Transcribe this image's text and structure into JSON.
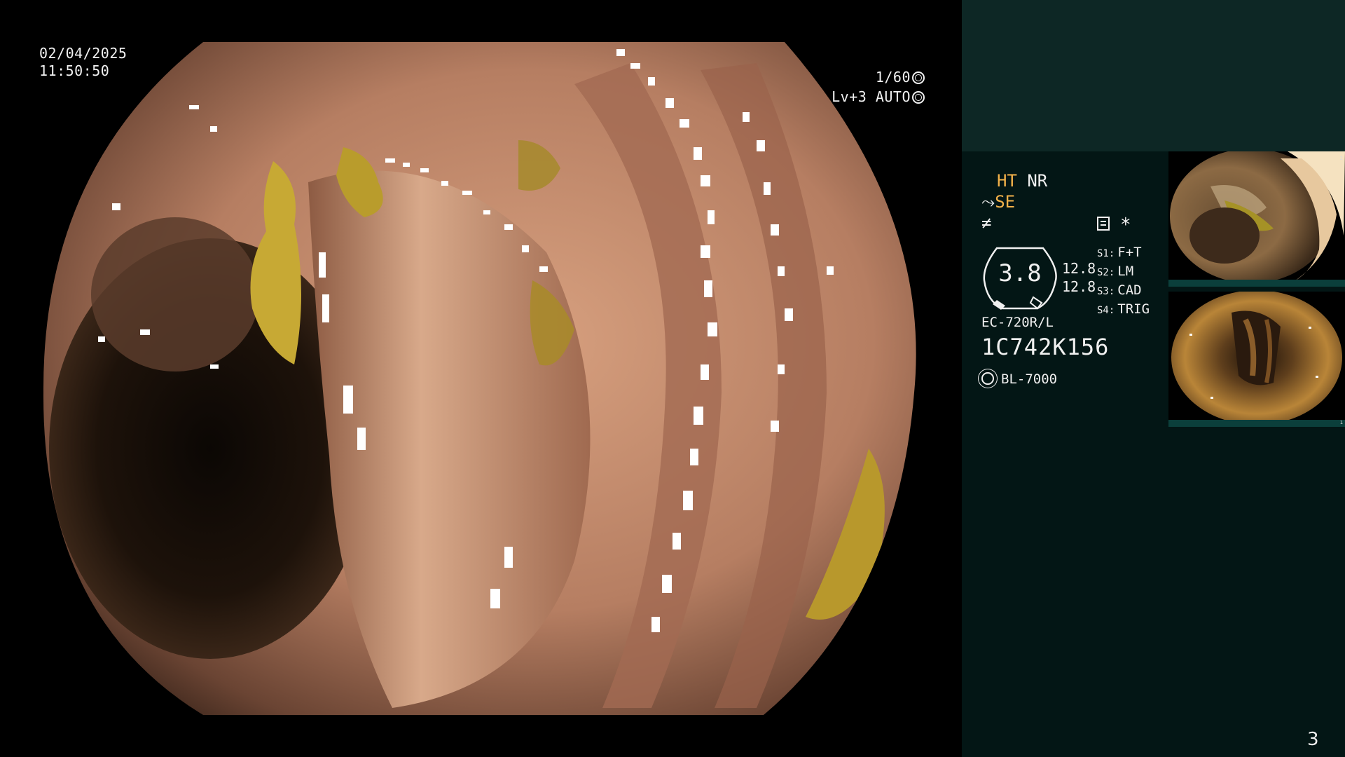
{
  "overlay": {
    "date": "02/04/2025",
    "time": "11:50:50",
    "shutter": "1/60",
    "level": "Lv+3 AUTO"
  },
  "panel": {
    "mode_ht": "HT",
    "mode_nr": "NR",
    "se": "SE",
    "f_symbol": "≠",
    "star": "*",
    "gauge_value": "3.8",
    "num_top": "12.8",
    "num_bottom": "12.8",
    "settings": [
      {
        "key": "S1:",
        "value": "F+T"
      },
      {
        "key": "S2:",
        "value": "LM"
      },
      {
        "key": "S3:",
        "value": "CAD"
      },
      {
        "key": "S4:",
        "value": "TRIG"
      }
    ],
    "scope_model": "EC-720R/L",
    "scope_serial": "1C742K156",
    "light_source": "BL-7000"
  },
  "thumbnails": [
    {
      "index": "2"
    },
    {
      "index": "1"
    }
  ],
  "page_number": "3",
  "colors": {
    "panel_bg": "#031615",
    "panel_top_bg": "#0d2725",
    "accent_orange": "#f3b24a"
  }
}
